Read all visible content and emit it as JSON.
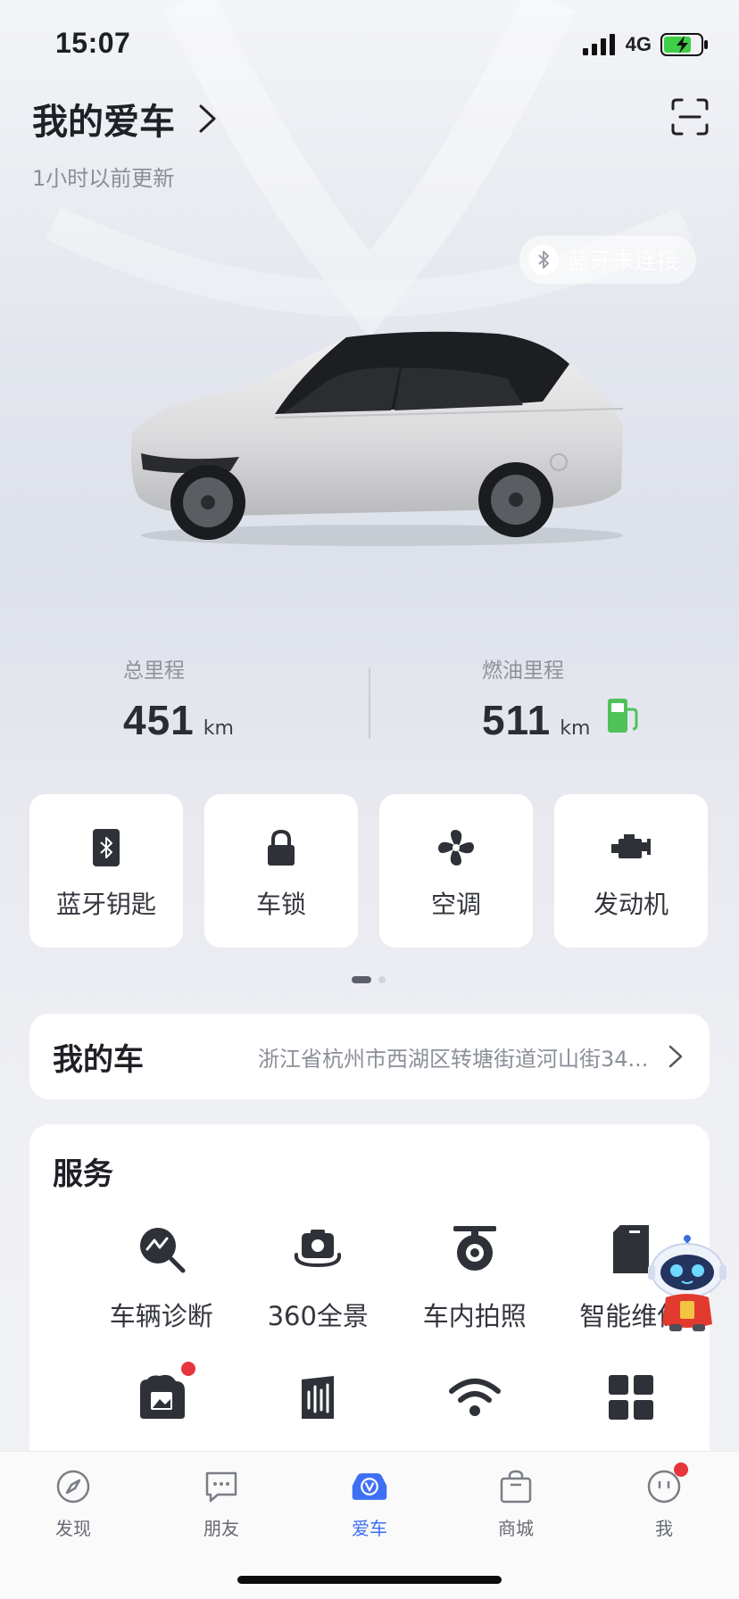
{
  "status_bar": {
    "time": "15:07",
    "network": "4G"
  },
  "header": {
    "title": "我的爱车",
    "update_text": "1小时以前更新"
  },
  "bluetooth_status": "蓝牙未连接",
  "stats": {
    "total_label": "总里程",
    "total_value": "451",
    "total_unit": "km",
    "fuel_label": "燃油里程",
    "fuel_value": "511",
    "fuel_unit": "km"
  },
  "controls": [
    {
      "label": "蓝牙钥匙",
      "icon": "bluetooth-key-icon"
    },
    {
      "label": "车锁",
      "icon": "lock-icon"
    },
    {
      "label": "空调",
      "icon": "fan-icon"
    },
    {
      "label": "发动机",
      "icon": "engine-icon"
    }
  ],
  "my_car": {
    "title": "我的车",
    "address": "浙江省杭州市西湖区转塘街道河山街34..."
  },
  "services": {
    "title": "服务",
    "row1": [
      {
        "label": "车辆诊断",
        "icon": "diagnosis-icon"
      },
      {
        "label": "360全景",
        "icon": "camera-360-icon"
      },
      {
        "label": "车内拍照",
        "icon": "dashcam-icon"
      },
      {
        "label": "智能维保",
        "icon": "maintenance-icon"
      }
    ],
    "row2": [
      {
        "icon": "photo-album-icon",
        "badge": true
      },
      {
        "icon": "sound-wave-icon"
      },
      {
        "icon": "wifi-icon"
      },
      {
        "icon": "grid-more-icon"
      }
    ]
  },
  "tabs": [
    {
      "label": "发现",
      "icon": "compass-icon"
    },
    {
      "label": "朋友",
      "icon": "chat-icon"
    },
    {
      "label": "爱车",
      "icon": "car-icon",
      "active": true
    },
    {
      "label": "商城",
      "icon": "shopping-bag-icon"
    },
    {
      "label": "我",
      "icon": "face-icon",
      "badge": true
    }
  ],
  "colors": {
    "accent": "#3e6ff5",
    "badge": "#e8343b",
    "fuel_pump": "#4fc35a"
  }
}
